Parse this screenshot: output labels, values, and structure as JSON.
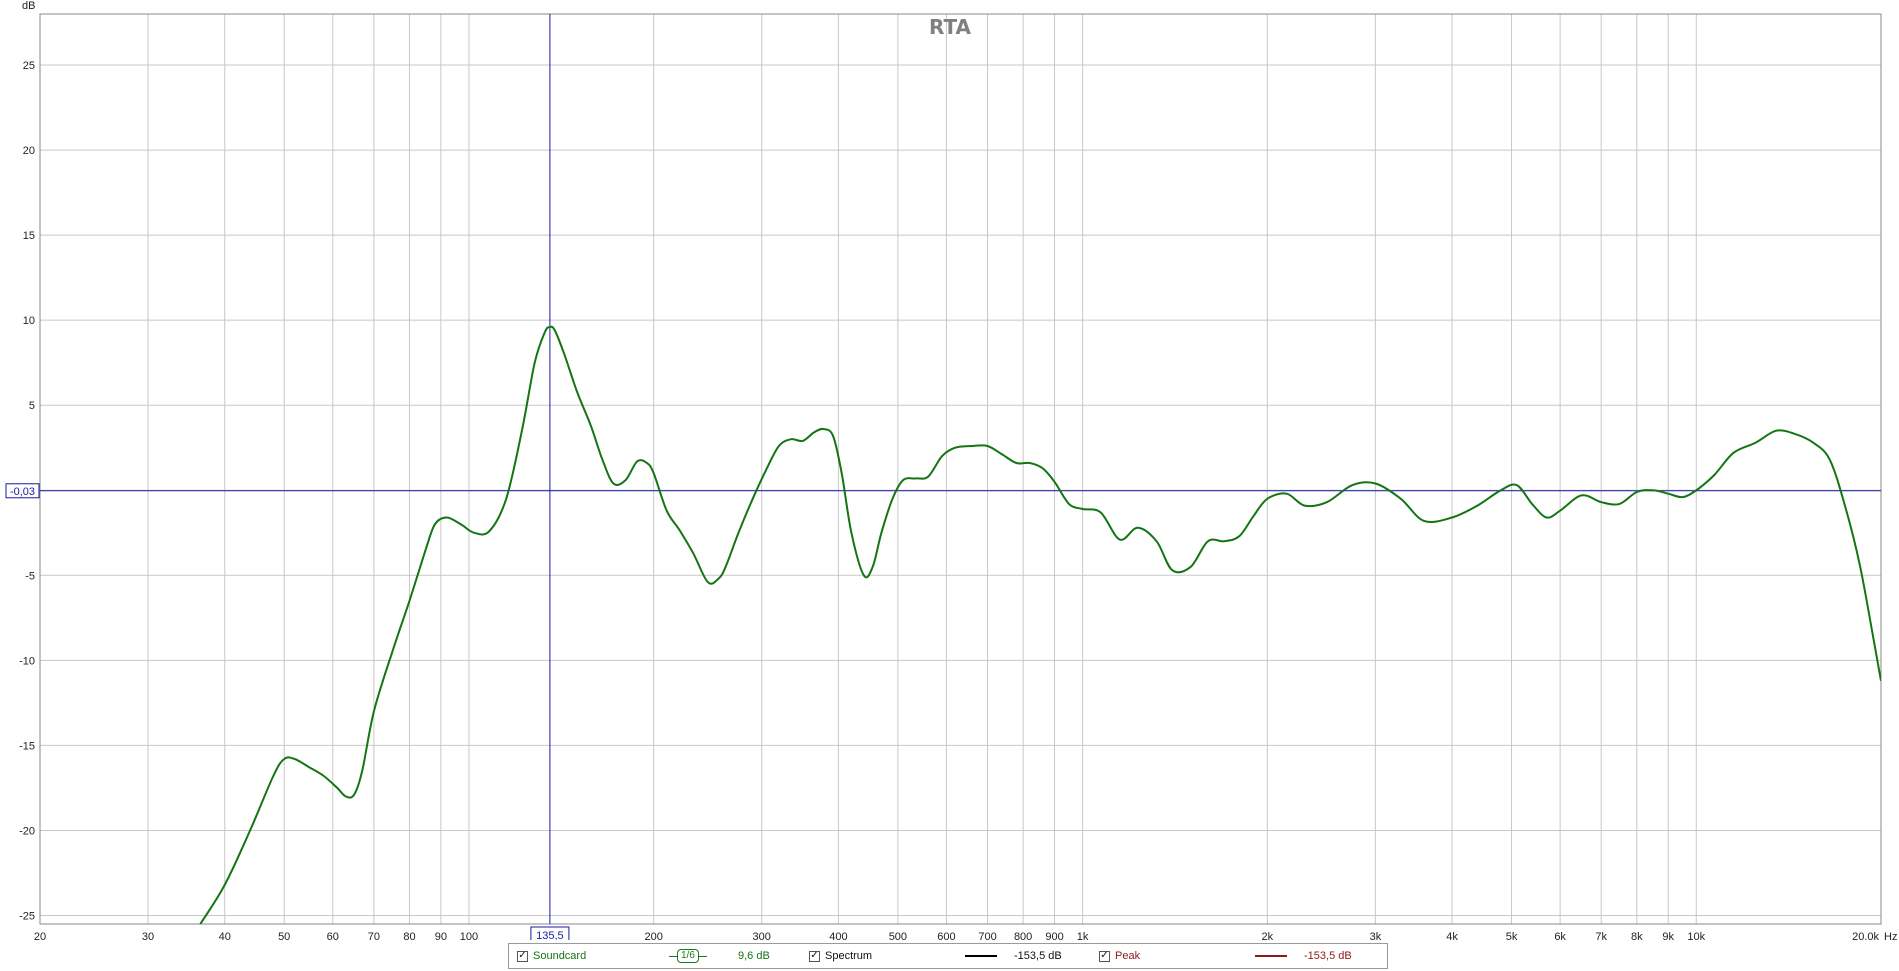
{
  "chart_data": {
    "type": "line",
    "title": "RTA",
    "xlabel": "Hz",
    "ylabel": "dB",
    "xscale": "log",
    "xlim": [
      20,
      20000
    ],
    "ylim": [
      -25.5,
      28
    ],
    "x_ticks": [
      {
        "value": 20,
        "label": "20"
      },
      {
        "value": 30,
        "label": "30"
      },
      {
        "value": 40,
        "label": "40"
      },
      {
        "value": 50,
        "label": "50"
      },
      {
        "value": 60,
        "label": "60"
      },
      {
        "value": 70,
        "label": "70"
      },
      {
        "value": 80,
        "label": "80"
      },
      {
        "value": 90,
        "label": "90"
      },
      {
        "value": 100,
        "label": "100"
      },
      {
        "value": 200,
        "label": "200"
      },
      {
        "value": 300,
        "label": "300"
      },
      {
        "value": 400,
        "label": "400"
      },
      {
        "value": 500,
        "label": "500"
      },
      {
        "value": 600,
        "label": "600"
      },
      {
        "value": 700,
        "label": "700"
      },
      {
        "value": 800,
        "label": "800"
      },
      {
        "value": 900,
        "label": "900"
      },
      {
        "value": 1000,
        "label": "1k"
      },
      {
        "value": 2000,
        "label": "2k"
      },
      {
        "value": 3000,
        "label": "3k"
      },
      {
        "value": 4000,
        "label": "4k"
      },
      {
        "value": 5000,
        "label": "5k"
      },
      {
        "value": 6000,
        "label": "6k"
      },
      {
        "value": 7000,
        "label": "7k"
      },
      {
        "value": 8000,
        "label": "8k"
      },
      {
        "value": 9000,
        "label": "9k"
      },
      {
        "value": 10000,
        "label": "10k"
      },
      {
        "value": 20000,
        "label": "20,0k"
      }
    ],
    "y_ticks": [
      25,
      20,
      15,
      10,
      5,
      0,
      -5,
      -10,
      -15,
      -20,
      -25
    ],
    "y_tick_labels": [
      "25",
      "20",
      "15",
      "10",
      "5",
      "",
      "-5",
      "-10",
      "-15",
      "-20",
      "-25"
    ],
    "grid": true,
    "cursor": {
      "x": 135.5,
      "y": -0.03,
      "x_label": "135,5",
      "y_label": "-0,03",
      "color": "#1a1aa0"
    },
    "series": [
      {
        "name": "Soundcard",
        "color": "#137513",
        "x": [
          36.5,
          40,
          44,
          48,
          50,
          52,
          55,
          58,
          61,
          63,
          65,
          67,
          70,
          75,
          80,
          85,
          88,
          92,
          97,
          102,
          108,
          115,
          122,
          128,
          133,
          135.5,
          138,
          143,
          150,
          158,
          165,
          172,
          180,
          188,
          195,
          200,
          210,
          220,
          232,
          245,
          255,
          262,
          275,
          290,
          305,
          320,
          335,
          350,
          365,
          378,
          392,
          405,
          420,
          440,
          455,
          470,
          490,
          510,
          535,
          560,
          590,
          620,
          660,
          700,
          740,
          780,
          820,
          860,
          900,
          950,
          1000,
          1070,
          1150,
          1230,
          1320,
          1400,
          1500,
          1600,
          1700,
          1800,
          1900,
          2000,
          2150,
          2300,
          2500,
          2750,
          3000,
          3300,
          3600,
          4000,
          4400,
          4800,
          5100,
          5400,
          5700,
          6000,
          6500,
          7000,
          7500,
          8000,
          8500,
          9000,
          9500,
          10000,
          10700,
          11500,
          12500,
          13500,
          14500,
          15500,
          16500,
          17500,
          18500,
          19500,
          20000
        ],
        "values": [
          -25.5,
          -23.2,
          -20,
          -16.8,
          -15.8,
          -15.8,
          -16.3,
          -16.8,
          -17.5,
          -18.0,
          -17.9,
          -16.5,
          -13.0,
          -9.5,
          -6.5,
          -3.5,
          -2.0,
          -1.6,
          -2.0,
          -2.5,
          -2.4,
          -0.5,
          3.5,
          7.5,
          9.3,
          9.6,
          9.4,
          8.0,
          5.8,
          3.8,
          1.8,
          0.4,
          0.6,
          1.7,
          1.6,
          1.0,
          -1.2,
          -2.3,
          -3.7,
          -5.4,
          -5.2,
          -4.5,
          -2.5,
          -0.5,
          1.2,
          2.6,
          3.0,
          2.9,
          3.4,
          3.6,
          3.2,
          1.0,
          -2.5,
          -5.0,
          -4.5,
          -2.5,
          -0.5,
          0.6,
          0.7,
          0.8,
          2.0,
          2.5,
          2.6,
          2.6,
          2.1,
          1.6,
          1.6,
          1.3,
          0.5,
          -0.8,
          -1.1,
          -1.3,
          -2.9,
          -2.2,
          -3.0,
          -4.7,
          -4.5,
          -3.0,
          -3.0,
          -2.7,
          -1.5,
          -0.5,
          -0.2,
          -0.9,
          -0.7,
          0.3,
          0.4,
          -0.5,
          -1.8,
          -1.6,
          -0.9,
          0.0,
          0.3,
          -0.8,
          -1.6,
          -1.2,
          -0.3,
          -0.7,
          -0.8,
          -0.1,
          0.0,
          -0.2,
          -0.4,
          0.0,
          0.9,
          2.2,
          2.8,
          3.5,
          3.3,
          2.8,
          1.8,
          -1.0,
          -4.5,
          -9.0,
          -11.2
        ]
      },
      {
        "name": "Spectrum",
        "color": "#000000"
      },
      {
        "name": "Peak",
        "color": "#8b1a1a"
      }
    ]
  },
  "legend": {
    "soundcard_label": "Soundcard",
    "smoothing_label": "1/6",
    "soundcard_value": "9,6 dB",
    "spectrum_label": "Spectrum",
    "spectrum_value": "-153,5 dB",
    "peak_label": "Peak",
    "peak_value": "-153,5 dB",
    "check_glyph": "✓"
  }
}
